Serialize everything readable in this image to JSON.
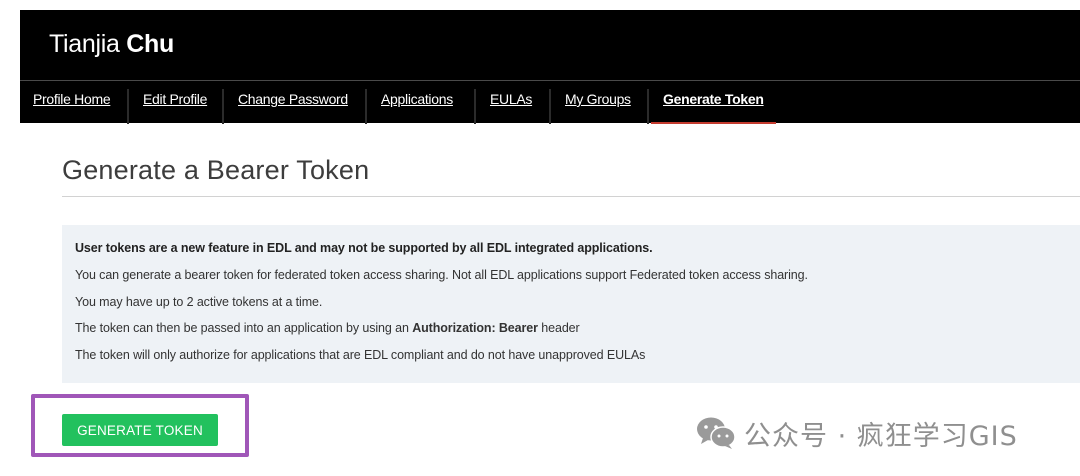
{
  "header": {
    "first_name": "Tianjia",
    "last_name": "Chu"
  },
  "nav": {
    "items": [
      {
        "label": "Profile Home"
      },
      {
        "label": "Edit Profile"
      },
      {
        "label": "Change Password"
      },
      {
        "label": "Applications"
      },
      {
        "label": "EULAs"
      },
      {
        "label": "My Groups"
      },
      {
        "label": "Generate Token"
      }
    ],
    "active": "Generate Token",
    "active_color": "#c43b2f"
  },
  "main": {
    "title": "Generate a Bearer Token",
    "info": {
      "line1": "User tokens are a new feature in EDL and may not be supported by all EDL integrated applications.",
      "line2": "You can generate a bearer token for federated token access sharing. Not all EDL applications support Federated token access sharing.",
      "line3": "You may have up to 2 active tokens at a time.",
      "line4_prefix": "The token can then be passed into an application by using an ",
      "line4_bold": "Authorization: Bearer",
      "line4_suffix": " header",
      "line5": "The token will only authorize for applications that are EDL compliant and do not have unapproved EULAs"
    },
    "button_label": "GENERATE TOKEN",
    "button_color": "#22c15e",
    "highlight_color": "#a057b8"
  },
  "watermark": {
    "text": "公众号 · 疯狂学习GIS",
    "icon": "wechat-icon"
  }
}
